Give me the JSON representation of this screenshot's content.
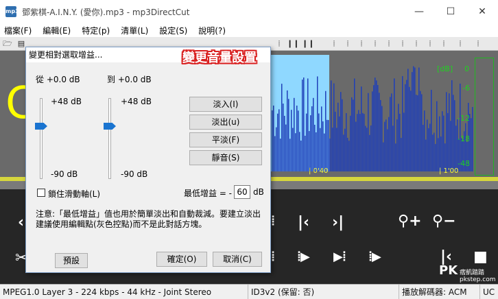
{
  "window": {
    "title": "鄧紫棋-A.I.N.Y. (愛你).mp3 - mp3DirectCut",
    "app_icon": "mp3",
    "minimize": "—",
    "maximize": "☐",
    "close": "✕"
  },
  "menu": [
    "檔案(F)",
    "編輯(E)",
    "特定(p)",
    "清單(L)",
    "設定(S)",
    "說明(?)"
  ],
  "waveform": {
    "db_unit": "[dB]",
    "db_ticks": [
      "0",
      "-6",
      "-12",
      "-18",
      "-48"
    ],
    "time_marks": [
      "| 0'40",
      "| 1'00"
    ],
    "level_char": "C"
  },
  "annotation": "變更音量設置",
  "dialog": {
    "title": "變更相對選取增益...",
    "from_label": "從 +0.0 dB",
    "to_label": "到 +0.0 dB",
    "left_max": "+48 dB",
    "left_min": "-90 dB",
    "right_max": "+48 dB",
    "right_min": "-90 dB",
    "buttons": {
      "fade_in": "淡入(I)",
      "fade_out": "淡出(u)",
      "flat": "平淡(F)",
      "mute": "靜音(S)",
      "default": "預設",
      "ok": "確定(O)",
      "cancel": "取消(C)"
    },
    "lock_slider_label": "鎖住滑動軸(L)",
    "min_gain_label": "最低增益 = -",
    "min_gain_value": "60",
    "min_gain_unit": "dB",
    "note": "注意:「最低增益」值也用於簡單淡出和自動裁減。要建立淡出建議使用編輯點(灰色控點)而不是此對話方塊。"
  },
  "status": {
    "format": "MPEG1.0 Layer 3 - 224 kbps - 44 kHz - Joint Stereo",
    "id3": "ID3v2 (保留: 否)",
    "decoder": "播放解碼器: ACM",
    "extra": "UC"
  },
  "watermark": {
    "logo": "PK",
    "text": "痞凱踏踏",
    "sub": "pkstep.com"
  },
  "colors": {
    "waveform_fill": "#1f3fb8",
    "selection": "#8fd8ff",
    "meter_green": "#20d020",
    "time_yellow": "#ffff30",
    "annotation_outline": "#d92020"
  }
}
